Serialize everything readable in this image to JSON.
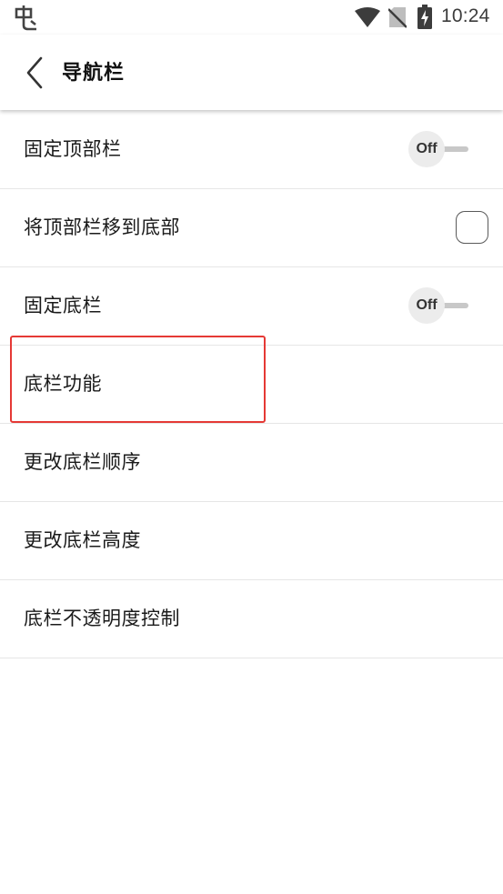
{
  "status_bar": {
    "app_icon": "bug-app-icon",
    "icons": [
      "wifi-icon",
      "no-sim-icon",
      "battery-charging-icon"
    ],
    "time": "10:24"
  },
  "app_bar": {
    "back_icon": "chevron-left-icon",
    "title": "导航栏"
  },
  "settings": {
    "items": [
      {
        "label": "固定顶部栏",
        "control": "toggle",
        "state_label": "Off"
      },
      {
        "label": "将顶部栏移到底部",
        "control": "checkbox",
        "checked": false
      },
      {
        "label": "固定底栏",
        "control": "toggle",
        "state_label": "Off"
      },
      {
        "label": "底栏功能",
        "control": "none",
        "highlighted": true
      },
      {
        "label": "更改底栏顺序",
        "control": "none"
      },
      {
        "label": "更改底栏高度",
        "control": "none"
      },
      {
        "label": "底栏不透明度控制",
        "control": "none"
      }
    ]
  },
  "colors": {
    "highlight": "#e53935",
    "divider": "#e6e6e6",
    "toggle_knob": "#ececec"
  }
}
